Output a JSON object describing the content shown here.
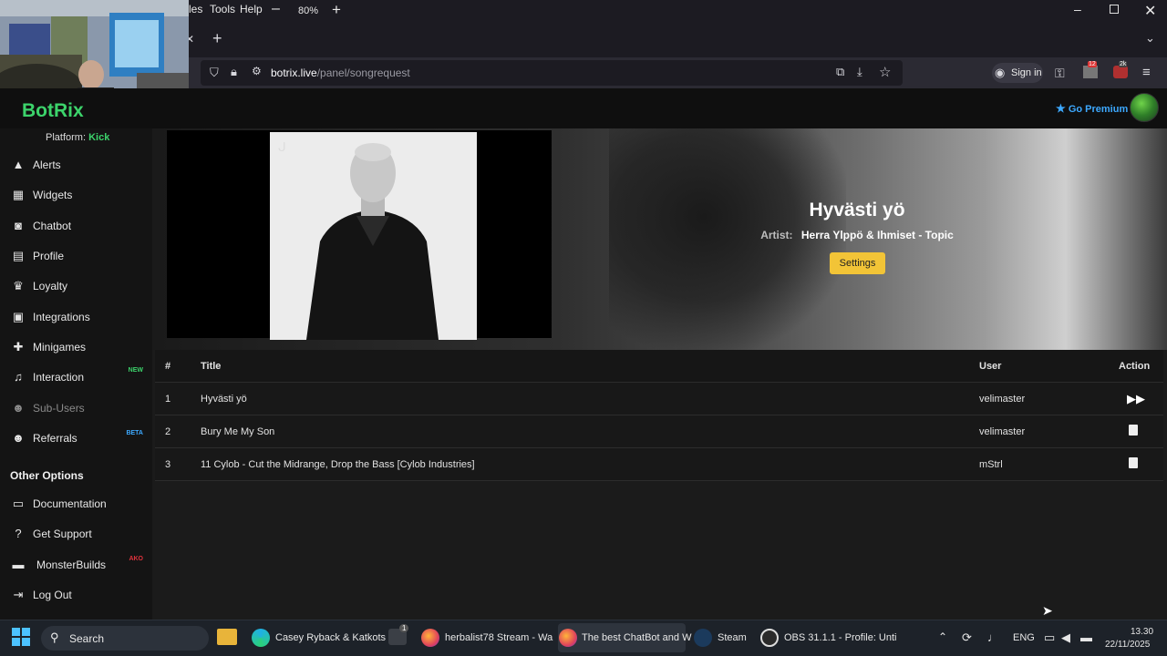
{
  "browser": {
    "menu": [
      "les",
      "Tools",
      "Help"
    ],
    "zoom": "80%",
    "url_host": "botrix.live",
    "url_path": "/panel/songrequest",
    "sign_in": "Sign in",
    "badge_count": "12",
    "ext_badge": "2k"
  },
  "header": {
    "logo": "BotRix",
    "premium_label": "Go Premium",
    "platform_prefix": "Platform:",
    "platform_value": "Kick"
  },
  "sidebar": {
    "items": [
      {
        "label": "Alerts",
        "icon": "warning-icon"
      },
      {
        "label": "Widgets",
        "icon": "grid-icon"
      },
      {
        "label": "Chatbot",
        "icon": "robot-icon"
      },
      {
        "label": "Profile",
        "icon": "id-card-icon"
      },
      {
        "label": "Loyalty",
        "icon": "trophy-icon"
      },
      {
        "label": "Integrations",
        "icon": "integrations-icon"
      },
      {
        "label": "Minigames",
        "icon": "gamepad-icon"
      },
      {
        "label": "Interaction",
        "icon": "music-note-icon",
        "badge": "NEW"
      },
      {
        "label": "Sub-Users",
        "icon": "users-icon"
      },
      {
        "label": "Referrals",
        "icon": "users-icon",
        "badge": "BETA"
      }
    ],
    "other_options_title": "Other Options",
    "other_items": [
      {
        "label": "Documentation",
        "icon": "book-icon"
      },
      {
        "label": "Get Support",
        "icon": "question-icon"
      },
      {
        "label": "MonsterBuilds",
        "icon": "laptop-icon",
        "badge": "AKO"
      },
      {
        "label": "Log Out",
        "icon": "logout-icon"
      }
    ]
  },
  "player": {
    "title": "Hyvästi yö",
    "artist_label": "Artist:",
    "artist": "Herra Ylppö & Ihmiset - Topic",
    "settings_label": "Settings"
  },
  "queue": {
    "columns": [
      "#",
      "Title",
      "User",
      "Action"
    ],
    "rows": [
      {
        "num": "1",
        "title": "Hyvästi yö",
        "user": "velimaster",
        "action": "skip-icon"
      },
      {
        "num": "2",
        "title": "Bury Me My Son",
        "user": "velimaster",
        "action": "trash-icon"
      },
      {
        "num": "3",
        "title": "11 Cylob - Cut the Midrange, Drop the Bass [Cylob Industries]",
        "user": "mStrl",
        "action": "trash-icon"
      }
    ]
  },
  "taskbar": {
    "search": "Search",
    "apps": [
      {
        "label": "Casey Ryback & Katkots"
      },
      {
        "label": "herbalist78 Stream - Wa"
      },
      {
        "label": "The best ChatBot and W"
      },
      {
        "label": "Steam"
      },
      {
        "label": "OBS 31.1.1 - Profile: Unti"
      }
    ],
    "store_badge": "1",
    "lang": "ENG",
    "time": "13.30",
    "date": "22/11/2025"
  },
  "colors": {
    "brand_green": "#3cd36b",
    "premium_blue": "#3da9ff",
    "settings_yellow": "#f2c437",
    "new_badge": "#3cd36b",
    "beta_badge": "#3da9ff",
    "ako_badge": "#e0323c"
  }
}
